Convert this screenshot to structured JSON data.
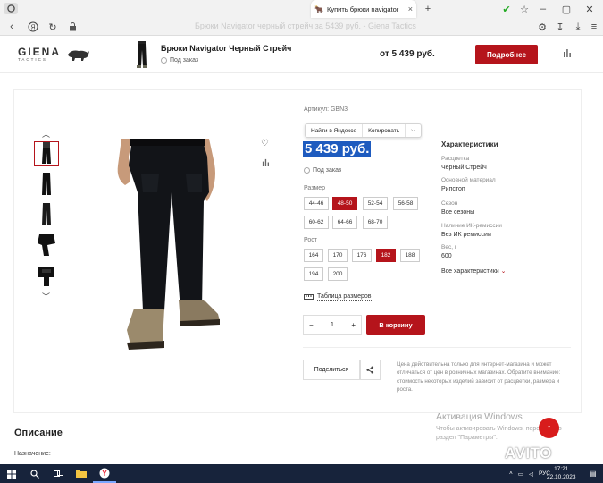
{
  "browser": {
    "tab_title": "Купить брюки navigator",
    "url_title": "Брюки Navigator черный стрейч за 5439 руб. - Giena Tactics"
  },
  "header": {
    "logo_name": "GIENA",
    "logo_sub": "TACTICS",
    "product_name": "Брюки Navigator Черный Стрейч",
    "availability": "Под заказ",
    "price": "от 5 439 руб.",
    "more_button": "Подробнее"
  },
  "product": {
    "sku": "Артикул: GBN3",
    "context_menu": [
      "Найти в Яндексе",
      "Копировать"
    ],
    "price": "5 439 руб.",
    "availability": "Под заказ",
    "size_label": "Размер",
    "sizes": [
      "44-46",
      "48-50",
      "52-54",
      "56-58",
      "60-62",
      "64-66",
      "68-70"
    ],
    "selected_size": "48-50",
    "height_label": "Рост",
    "heights": [
      "164",
      "170",
      "176",
      "182",
      "188",
      "194",
      "200"
    ],
    "selected_height": "182",
    "size_table": "Таблица размеров",
    "quantity": "1",
    "qty_minus": "−",
    "qty_plus": "+",
    "cart_button": "В корзину",
    "share_button": "Поделиться",
    "price_note": "Цена действительна только для интернет-магазина и может отличаться от цен в розничных магазинах. Обратите внимание: стоимость некоторых изделий зависит от расцветки, размера и роста."
  },
  "characteristics": {
    "title": "Характеристики",
    "items": [
      {
        "key": "Расцветка",
        "value": "Черный Стрейч"
      },
      {
        "key": "Основной материал",
        "value": "Рипстоп"
      },
      {
        "key": "Сезон",
        "value": "Все сезоны"
      },
      {
        "key": "Наличие ИК-ремиссии",
        "value": "Без ИК ремиссии"
      },
      {
        "key": "Вес, г",
        "value": "600"
      }
    ],
    "more": "Все характеристики"
  },
  "description": {
    "title": "Описание",
    "purpose": "Назначение:"
  },
  "overlay": {
    "activation_title": "Активация Windows",
    "activation_text": "Чтобы активировать Windows, перейдите в раздел \"Параметры\".",
    "watermark": "AVITO"
  },
  "taskbar": {
    "lang": "РУС",
    "time": "17:21",
    "date": "22.10.2023"
  },
  "colors": {
    "accent_red": "#b5141b",
    "selection_blue": "#1e5bbf",
    "taskbar": "#17233b"
  }
}
